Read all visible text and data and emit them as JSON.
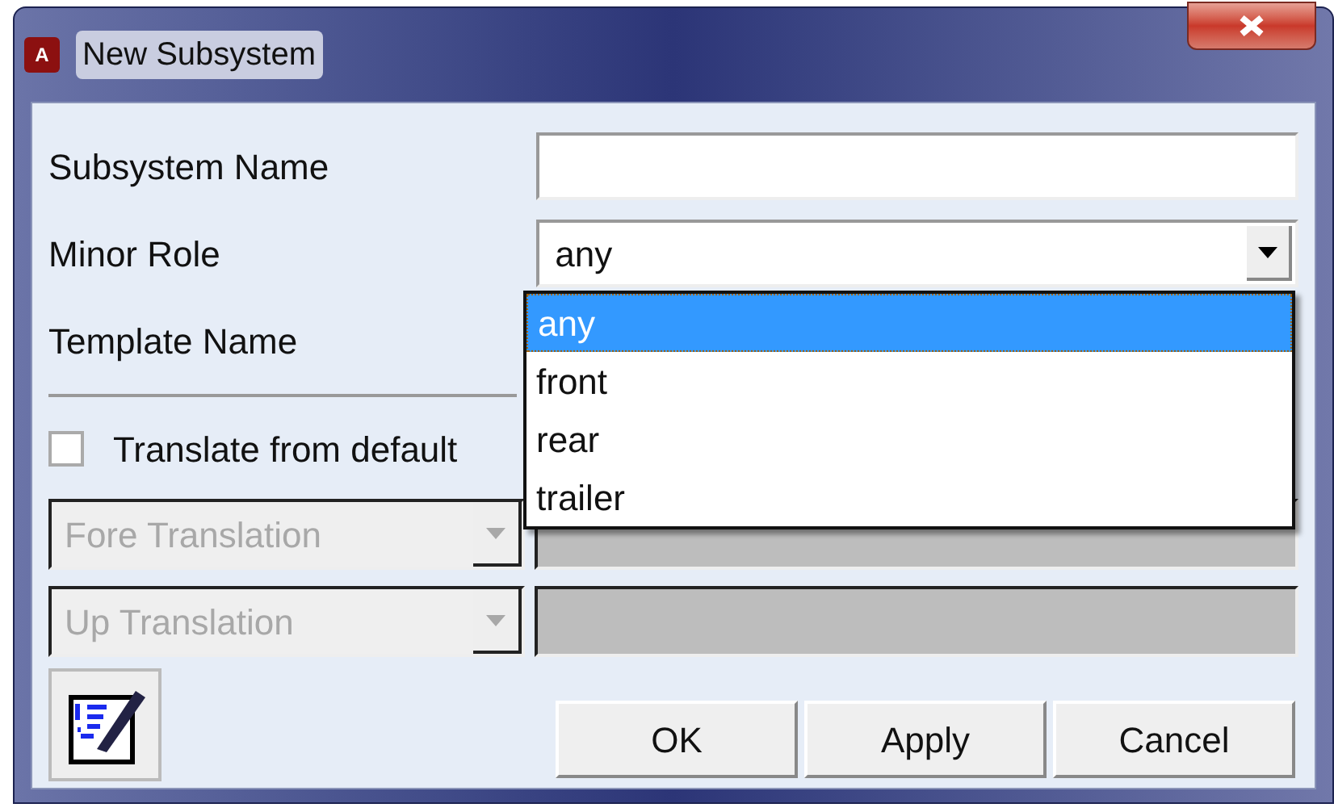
{
  "window": {
    "title": "New Subsystem",
    "app_icon": "A"
  },
  "rows": [
    {
      "kind": "text",
      "label": "Subsystem Name",
      "value": ""
    },
    {
      "kind": "combo",
      "label": "Minor Role",
      "value": "any"
    },
    {
      "kind": "label",
      "label": "Template Name"
    }
  ],
  "dropdown": {
    "options": [
      {
        "label": "any",
        "selected": true
      },
      {
        "label": "front",
        "selected": false
      },
      {
        "label": "rear",
        "selected": false
      },
      {
        "label": "trailer",
        "selected": false
      }
    ]
  },
  "translate": {
    "label": "Translate from default",
    "checked": false
  },
  "translations": [
    {
      "label": "Fore Translation",
      "disabled": true
    },
    {
      "label": "Up Translation",
      "disabled": true
    }
  ],
  "buttons": [
    "OK",
    "Apply",
    "Cancel"
  ]
}
